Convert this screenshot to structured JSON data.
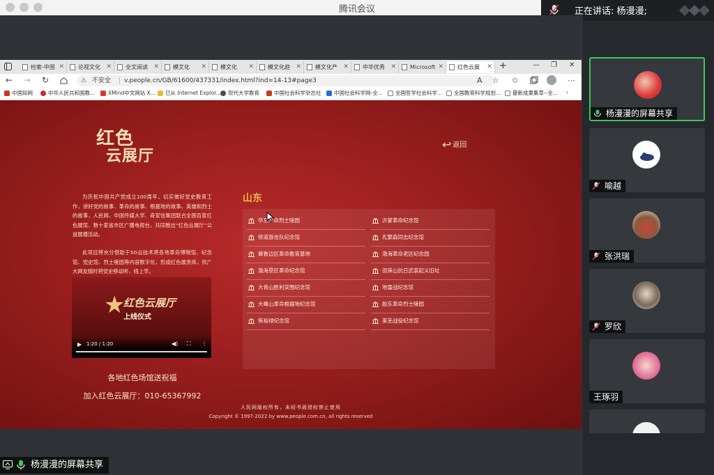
{
  "meeting": {
    "app_title": "腾讯会议",
    "speaking": "正在讲话: 杨漫漫;",
    "share_label": "杨漫漫的屏幕共享"
  },
  "browser": {
    "tabs": [
      {
        "label": "检索-中国"
      },
      {
        "label": "论视文化"
      },
      {
        "label": "全文阅读"
      },
      {
        "label": "模文化"
      },
      {
        "label": "模文化"
      },
      {
        "label": "模文化趋"
      },
      {
        "label": "模文化产"
      },
      {
        "label": "中华优秀"
      },
      {
        "label": "Microsoft"
      },
      {
        "label": "红色云展"
      }
    ],
    "insecure_label": "不安全",
    "url": "v.people.cn/GB/61600/437331/index.html?ind=14-13#page3",
    "favorites": [
      "中国知网",
      "中华人民共和国教...",
      "XMind中文网站 X...",
      "已从 Internet Explor...",
      "现代大学教育",
      "中国社会科学杂志社",
      "中国社会科学网-全...",
      "全国哲学社会科学...",
      "全国教育科学规划...",
      "最新成果集萃--全..."
    ]
  },
  "site": {
    "logo_line1": "红色",
    "logo_line2": "云展厅",
    "back_label": "返回",
    "intro_p1": "为庆祝中国共产党成立100周年，切实做好党史教育工作，讲好党的故事、革命的故事、根据地的故事、英雄和烈士的故事，人民网、中国传媒大学、奇安信集团联合全国百家红色展馆、数十家省市区广播电视台，共同推出“红色云展厅”公益展播活动。",
    "intro_p2": "此项目将充分借助于5G云技术将各地革命博物馆、纪念馆、党史馆、烈士陵园等内容数字化，形成红色展资库，供广大网友随时将党史移动听、线上学。",
    "video": {
      "title_big": "红色云展厅",
      "title_sub": "上线仪式",
      "time": "1:20 / 1:20"
    },
    "caption1": "各地红色场馆送祝福",
    "caption2": "加入红色云展厅：010-65367992",
    "province": "山东",
    "museums_left": [
      "华东革命烈士陵园",
      "铁道游击队纪念馆",
      "冀鲁边区革命教育基地",
      "渤海垦区革命纪念馆",
      "大青山胜利突围纪念馆",
      "大峰山革命根据地纪念馆",
      "焦裕禄纪念馆"
    ],
    "museums_right": [
      "沂蒙革命纪念馆",
      "孔繁森同志纪念馆",
      "渤海革命老区纪念园",
      "徂徕山抗日武装起义旧址",
      "地雷战纪念馆",
      "胶东革命烈士陵园",
      "莱芜战役纪念馆"
    ],
    "footer1": "人民网版权所有，未经书面授权禁止使用",
    "footer2": "Copyright © 1997-2022 by www.people.com.cn, all rights reserved"
  },
  "participants": [
    {
      "name": "杨漫漫的屏幕共享"
    },
    {
      "name": "喻越"
    },
    {
      "name": "张洪瑞"
    },
    {
      "name": "罗欣"
    },
    {
      "name": "王琢羽"
    }
  ],
  "colors": {
    "page_red": "#9a1e1e",
    "gold_text": "#f1b34a",
    "speaker_border": "#3fc75a"
  }
}
